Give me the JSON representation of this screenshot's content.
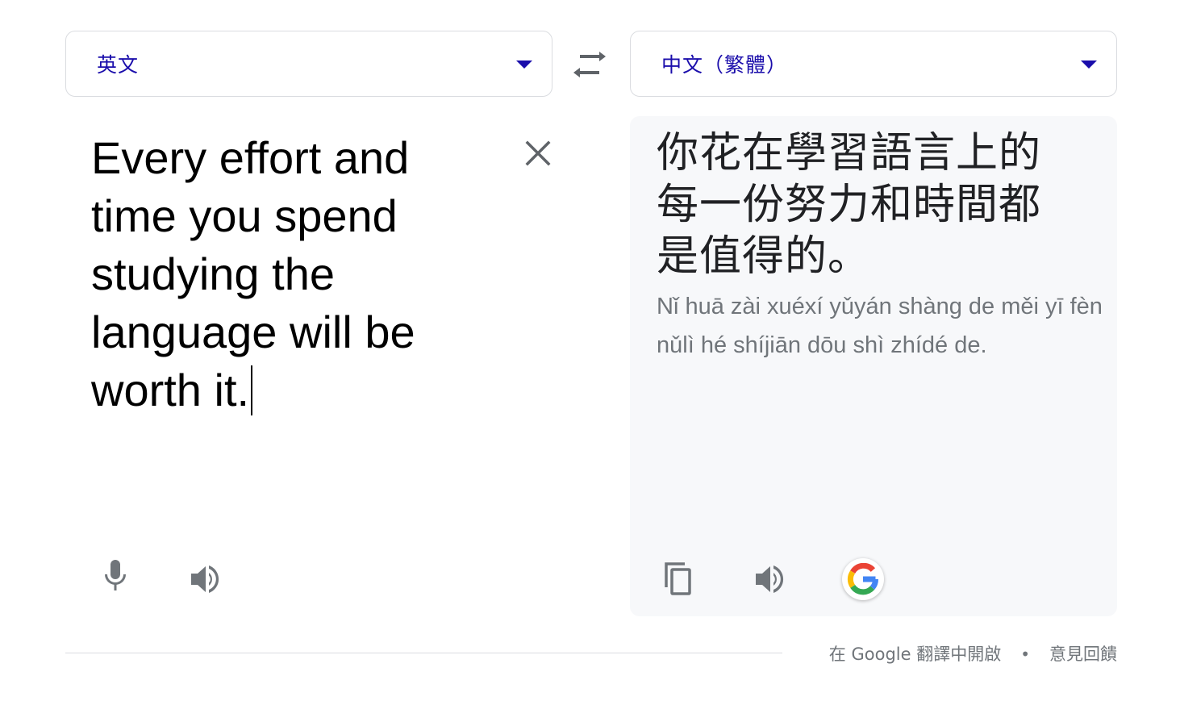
{
  "source_language": {
    "label": "英文"
  },
  "target_language": {
    "label": "中文（繁體）"
  },
  "source": {
    "text": "Every effort and time you spend studying the language will be worth it."
  },
  "translation": {
    "text": "你花在學習語言上的每一份努力和時間都是值得的。",
    "romanization": "Nǐ huā zài xuéxí yǔyán shàng de měi yī fèn nǔlì hé shíjiān dōu shì zhídé de."
  },
  "footer": {
    "open_link": "在 Google 翻譯中開啟",
    "separator": "•",
    "feedback_link": "意見回饋"
  },
  "icons": {
    "swap": "swap-languages-icon",
    "clear": "close-icon",
    "mic": "microphone-icon",
    "speaker": "volume-icon",
    "copy": "copy-icon",
    "google": "google-g-icon"
  },
  "colors": {
    "accent": "#1a0dab",
    "icon_gray": "#70757a",
    "panel_bg": "#f7f8fa",
    "border": "#dadce0"
  }
}
